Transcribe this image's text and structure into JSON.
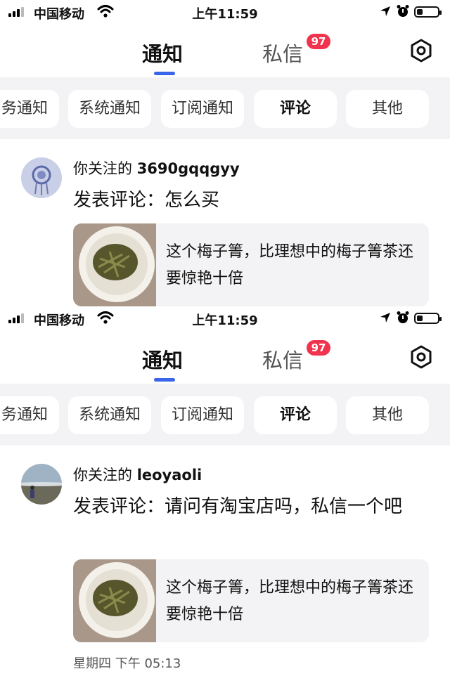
{
  "status_bar": {
    "carrier": "中国移动",
    "time": "上午11:59"
  },
  "header": {
    "tab_notify": "通知",
    "tab_messages": "私信",
    "messages_badge": "97"
  },
  "categories": [
    {
      "label": "务通知"
    },
    {
      "label": "系统通知"
    },
    {
      "label": "订阅通知"
    },
    {
      "label": "评论",
      "active": true
    },
    {
      "label": "其他"
    }
  ],
  "items": [
    {
      "user_prefix": "你关注的",
      "username": "3690gqqgyy",
      "comment": "发表评论：怎么买",
      "ref_text": "这个梅子箐，比理想中的梅子箐茶还要惊艳十倍"
    },
    {
      "user_prefix": "你关注的",
      "username": "leoyaoli",
      "comment": "发表评论：请问有淘宝店吗，私信一个吧",
      "ref_text": "这个梅子箐，比理想中的梅子箐茶还要惊艳十倍",
      "timestamp": "星期四 下午 05:13"
    }
  ],
  "colors": {
    "accent": "#3a64ea",
    "badge": "#f0344e",
    "filter_bg": "#f3f3f5"
  }
}
